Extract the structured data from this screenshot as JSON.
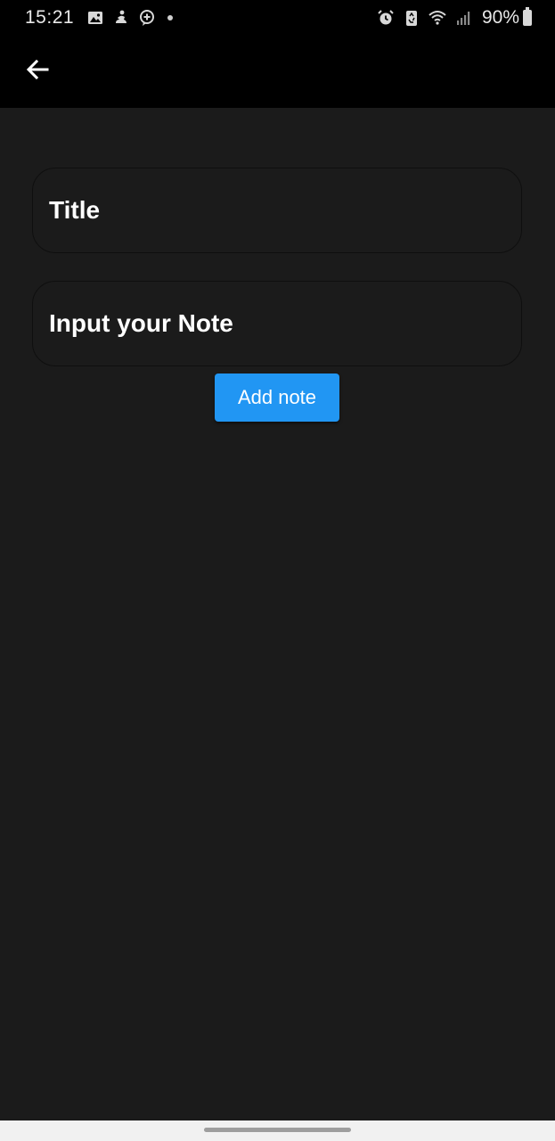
{
  "status_bar": {
    "time": "15:21",
    "battery_percent": "90%",
    "left_icons": [
      "gallery-icon",
      "figure-icon",
      "chat-plus-icon",
      "dot-icon"
    ],
    "right_icons": [
      "alarm-icon",
      "recycle-icon",
      "wifi-icon",
      "signal-icon",
      "battery-icon"
    ]
  },
  "app_bar": {
    "back_icon": "back-arrow-icon"
  },
  "form": {
    "title_placeholder": "Title",
    "title_value": "",
    "note_placeholder": "Input your Note",
    "note_value": "",
    "add_button_label": "Add note"
  },
  "colors": {
    "background": "#1b1b1b",
    "app_bar": "#000000",
    "accent": "#2196f3",
    "text": "#ffffff",
    "nav_bar": "#f1f1f1"
  }
}
